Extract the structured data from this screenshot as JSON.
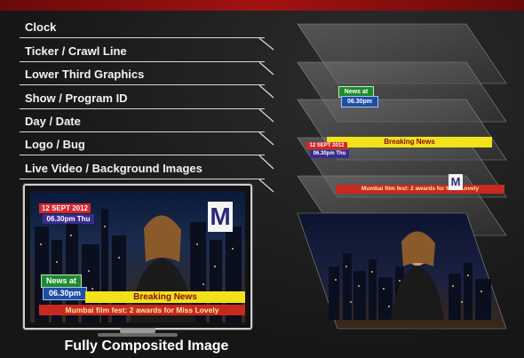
{
  "layers": [
    "Clock",
    "Ticker / Crawl Line",
    "Lower Third Graphics",
    "Show / Program ID",
    "Day / Date",
    "Logo / Bug",
    "Live Video / Background Images"
  ],
  "graphics": {
    "date_text": "12 SEPT 2012",
    "day_time_text": "06.30pm Thu",
    "news_at_text": "News at",
    "news_time_text": "06.30pm",
    "breaking_text": "Breaking News",
    "ticker_text": "Mumbai film fest: 2 awards for Miss Lovely",
    "logo_letter": "M"
  },
  "caption": "Fully Composited Image",
  "colors": {
    "top_accent": "#a31212",
    "date_red": "#d8252b",
    "time_purple": "#3a2b8f",
    "news_green": "#1e8a2e",
    "news_blue": "#1f4ea3",
    "breaking_yellow": "#f2e21a",
    "ticker_red": "#c9281f"
  }
}
